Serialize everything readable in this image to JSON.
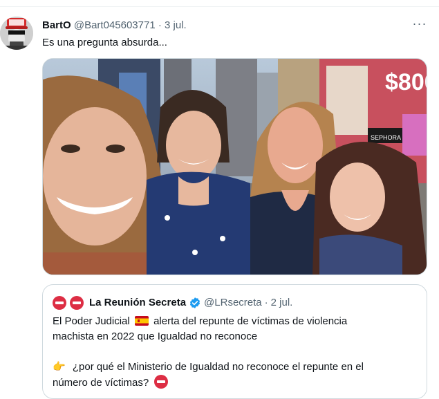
{
  "tweet": {
    "display_name": "BartO",
    "handle": "@Bart045603771",
    "separator": "·",
    "date": "3 jul.",
    "more_label": "···",
    "text": "Es una pregunta absurda..."
  },
  "quoted_tweet": {
    "display_name": "La Reunión Secreta",
    "handle": "@LRsecreta",
    "separator": "·",
    "date": "2 jul.",
    "line1_before_flag": "El Poder Judicial",
    "line1_after_flag": "alerta del repunte de víctimas de violencia",
    "line2": "machista en 2022 que Igualdad no reconoce",
    "line3": "¿por qué el Ministerio de Igualdad no reconoce el repunte en el",
    "line4": "número de víctimas?",
    "icons": {
      "prefix": [
        "no-entry-icon",
        "no-entry-icon"
      ],
      "flag": "spain-flag-icon",
      "pointer": "backhand-index-pointing-right-icon",
      "verified": "verified-badge-icon",
      "suffix": "no-entry-icon"
    }
  },
  "photo": {
    "billboard_text": "$800",
    "store_sign": "SEPHORA"
  },
  "colors": {
    "text_primary": "#0f1419",
    "text_secondary": "#536471",
    "border": "#cfd9de",
    "verified": "#1d9bf0",
    "no_entry": "#dd2e44"
  }
}
